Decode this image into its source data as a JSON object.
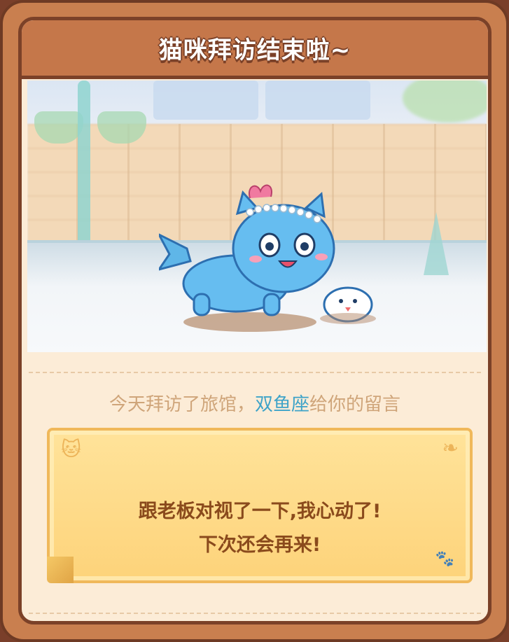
{
  "title": "猫咪拜访结束啦~",
  "visit_message": {
    "prefix": "今天拜访了旅馆，",
    "visitor_name": "双鱼座",
    "suffix": "给你的留言"
  },
  "note": {
    "line1": "跟老板对视了一下,我心动了!",
    "line2": "下次还会再来!"
  },
  "colors": {
    "frame": "#c97f4f",
    "title_bar": "#c5774a",
    "accent_name": "#3ea3c8",
    "note_text": "#8a4a1c"
  }
}
